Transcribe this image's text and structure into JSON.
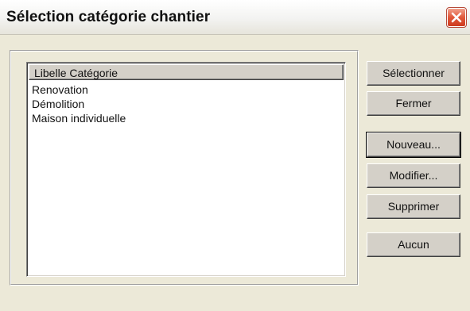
{
  "window": {
    "title": "Sélection catégorie chantier"
  },
  "list": {
    "header": "Libelle Catégorie",
    "items": [
      "Renovation",
      "Démolition",
      "Maison individuelle"
    ]
  },
  "buttons": {
    "select": "Sélectionner",
    "close": "Fermer",
    "new": "Nouveau...",
    "edit": "Modifier...",
    "delete": "Supprimer",
    "none": "Aucun"
  },
  "icons": {
    "close": "close-icon"
  },
  "colors": {
    "window_background": "#ece9d8",
    "close_button": "#e1583a",
    "list_background": "#ffffff"
  }
}
